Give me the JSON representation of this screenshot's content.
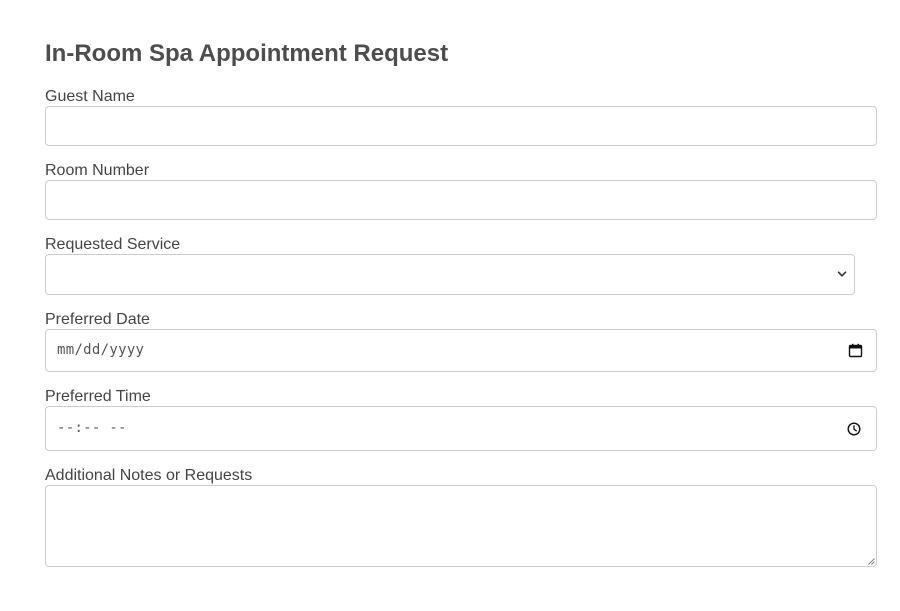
{
  "form": {
    "title": "In-Room Spa Appointment Request",
    "fields": {
      "guest_name": {
        "label": "Guest Name",
        "value": ""
      },
      "room_number": {
        "label": "Room Number",
        "value": ""
      },
      "requested_service": {
        "label": "Requested Service",
        "selected": ""
      },
      "preferred_date": {
        "label": "Preferred Date",
        "placeholder": "mm/dd/yyyy"
      },
      "preferred_time": {
        "label": "Preferred Time",
        "placeholder": "--:-- --"
      },
      "notes": {
        "label": "Additional Notes or Requests",
        "value": ""
      }
    }
  },
  "icons": {
    "select_arrow": "chevron-down-icon",
    "date_picker": "calendar-icon",
    "time_picker": "clock-icon",
    "textarea_resize": "resize-grip-icon"
  },
  "colors": {
    "title": "#4d4d4d",
    "label": "#444444",
    "border": "#cccccc",
    "background": "#ffffff"
  }
}
